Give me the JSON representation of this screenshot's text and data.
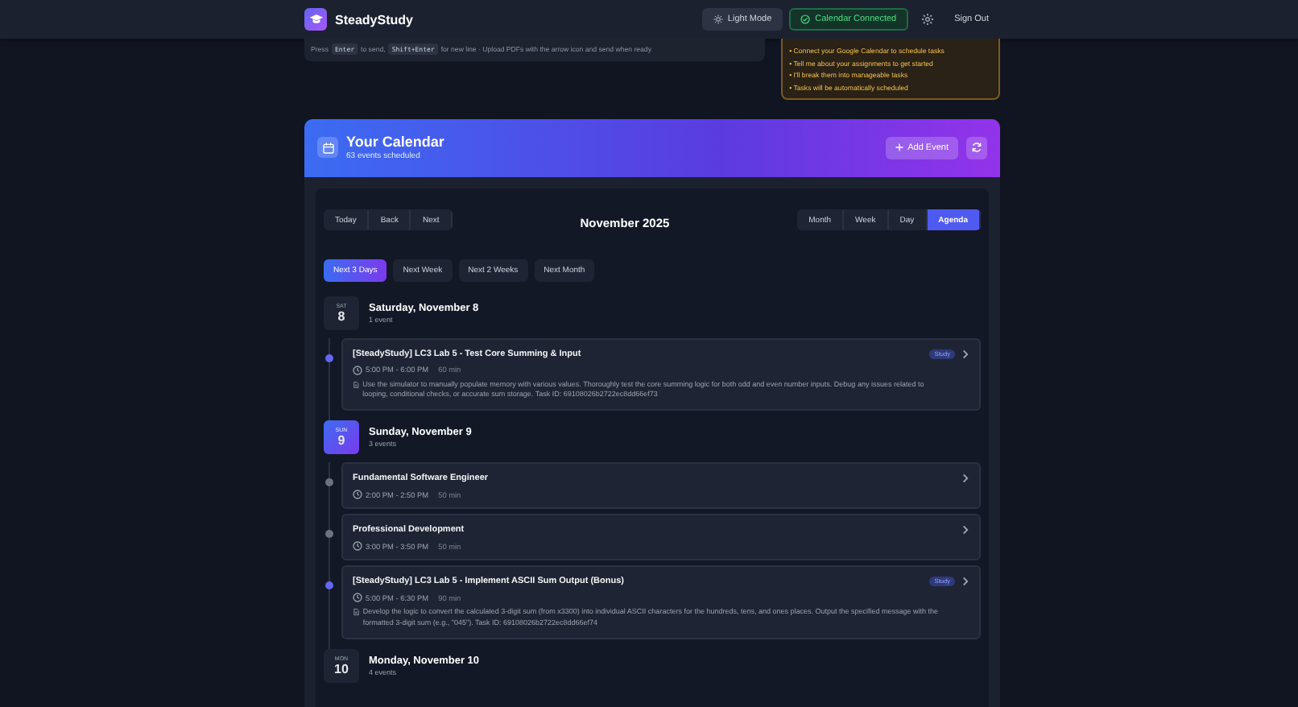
{
  "header": {
    "brand": "SteadyStudy",
    "buttons": [
      {
        "kind": "theme",
        "label": "Light Mode"
      },
      {
        "kind": "connected",
        "label": "Calendar Connected"
      }
    ],
    "sign_out": "Sign Out"
  },
  "chat_hint": [
    {
      "kind": "text",
      "text": "Press"
    },
    {
      "kind": "key",
      "text": "Enter"
    },
    {
      "kind": "text",
      "text": "to send,"
    },
    {
      "kind": "key",
      "text": "Shift+Enter"
    },
    {
      "kind": "text",
      "text": "for new line · Upload PDFs with the arrow icon and send when ready"
    }
  ],
  "tips": [
    "• Connect your Google Calendar to schedule tasks",
    "• Tell me about your assignments to get started",
    "• I'll break them into manageable tasks",
    "• Tasks will be automatically scheduled"
  ],
  "calendar": {
    "title": "Your Calendar",
    "subtitle": "63 events scheduled",
    "add_event": "Add Event",
    "nav": [
      "Today",
      "Back",
      "Next"
    ],
    "period": "November 2025",
    "views": [
      {
        "label": "Month",
        "selected": false
      },
      {
        "label": "Week",
        "selected": false
      },
      {
        "label": "Day",
        "selected": false
      },
      {
        "label": "Agenda",
        "selected": true
      }
    ],
    "ranges": [
      {
        "label": "Next 3 Days",
        "selected": true
      },
      {
        "label": "Next Week",
        "selected": false
      },
      {
        "label": "Next 2 Weeks",
        "selected": false
      },
      {
        "label": "Next Month",
        "selected": false
      }
    ],
    "days": [
      {
        "weekday": "SAT",
        "day": "8",
        "title": "Saturday, November 8",
        "count": "1 event",
        "today": false,
        "events": [
          {
            "title": "[SteadyStudy] LC3 Lab 5 - Test Core Summing & Input",
            "time": "5:00 PM - 6:00 PM",
            "duration": "60 min",
            "tag": "Study",
            "color": "#6366f1",
            "description": "Use the simulator to manually populate memory with various values. Thoroughly test the core summing logic for both odd and even number inputs. Debug any issues related to looping, conditional checks, or accurate sum storage. Task ID: 69108026b2722ec8dd66ef73"
          }
        ]
      },
      {
        "weekday": "SUN",
        "day": "9",
        "title": "Sunday, November 9",
        "count": "3 events",
        "today": true,
        "events": [
          {
            "title": "Fundamental Software Engineer",
            "time": "2:00 PM - 2:50 PM",
            "duration": "50 min",
            "color": "#6b7280"
          },
          {
            "title": "Professional Development",
            "time": "3:00 PM - 3:50 PM",
            "duration": "50 min",
            "color": "#6b7280"
          },
          {
            "title": "[SteadyStudy] LC3 Lab 5 - Implement ASCII Sum Output (Bonus)",
            "time": "5:00 PM - 6:30 PM",
            "duration": "90 min",
            "tag": "Study",
            "color": "#6366f1",
            "description": "Develop the logic to convert the calculated 3-digit sum (from x3300) into individual ASCII characters for the hundreds, tens, and ones places. Output the specified message with the formatted 3-digit sum (e.g., \"045\"). Task ID: 69108026b2722ec8dd66ef74"
          }
        ]
      },
      {
        "weekday": "MON",
        "day": "10",
        "title": "Monday, November 10",
        "count": "4 events",
        "today": false
      }
    ]
  }
}
